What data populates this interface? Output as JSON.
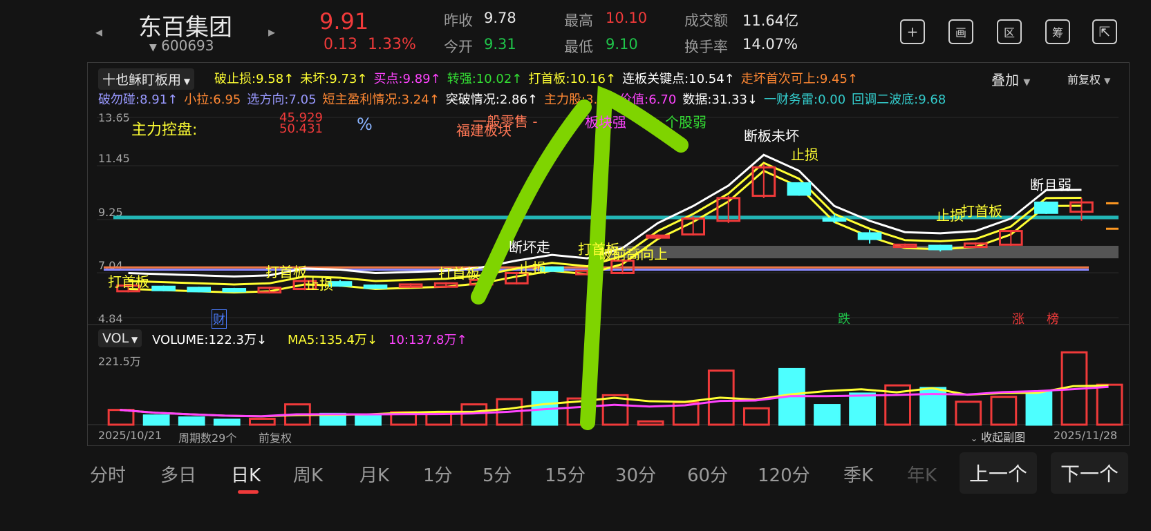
{
  "header": {
    "stock_name": "东百集团",
    "stock_code": "600693",
    "price": "9.91",
    "change": "0.13",
    "change_pct": "1.33%",
    "prev_close_label": "昨收",
    "prev_close": "9.78",
    "open_label": "今开",
    "open": "9.31",
    "high_label": "最高",
    "high": "10.10",
    "low_label": "最低",
    "low": "9.10",
    "amount_label": "成交额",
    "amount": "11.64亿",
    "turnover_label": "换手率",
    "turnover": "14.07%",
    "tools": [
      "+",
      "画",
      "区",
      "筹",
      "⇱"
    ]
  },
  "indicators": {
    "selector": "十也稣盯板用",
    "row1": [
      {
        "text": "破止损:9.58↑",
        "color": "#ffff33"
      },
      {
        "text": "未坏:9.73↑",
        "color": "#ffff33"
      },
      {
        "text": "买点:9.89↑",
        "color": "#ff44ff"
      },
      {
        "text": "转强:10.02↑",
        "color": "#33dd33"
      },
      {
        "text": "打首板:10.16↑",
        "color": "#ffff33"
      },
      {
        "text": "连板关键点:10.54↑",
        "color": "#ffffff"
      },
      {
        "text": "走坏首次可上:9.45↑",
        "color": "#ff8833"
      }
    ],
    "row2": [
      {
        "text": "破勿碰:8.91↑",
        "color": "#9999ff"
      },
      {
        "text": "小拉:6.95",
        "color": "#ff8833"
      },
      {
        "text": "选方向:7.05",
        "color": "#9999ff"
      },
      {
        "text": "短主盈利情况:3.24↑",
        "color": "#ff8833"
      },
      {
        "text": "突破情况:2.86↑",
        "color": "#ffffff"
      },
      {
        "text": "主力股:3.21",
        "color": "#ff8833"
      },
      {
        "text": "价值:6.70",
        "color": "#ff44ff"
      },
      {
        "text": "数据:31.33↓",
        "color": "#ffffff"
      },
      {
        "text": "一财务雷:0.00",
        "color": "#33cccc"
      },
      {
        "text": "回调二波底:9.68",
        "color": "#33cccc"
      }
    ],
    "overlay": "叠加",
    "adjust": "前复权"
  },
  "price_axis": [
    "13.65",
    "11.45",
    "9.25",
    "7.04",
    "4.84"
  ],
  "chart_notes": {
    "main_force": "主力控盘:",
    "main_force_pct1": "45.929",
    "main_force_pct2": "50.431",
    "pct_sign": "%",
    "sector1": "福建板块",
    "sector2": "一般零售 -",
    "sector_strength": "板块强",
    "stock_weak": "个股弱",
    "labels": [
      {
        "text": "打首板",
        "color": "#ffff33"
      },
      {
        "text": "打首板",
        "color": "#ffff33"
      },
      {
        "text": "止损",
        "color": "#ffff33"
      },
      {
        "text": "打首板",
        "color": "#ffff33"
      },
      {
        "text": "断坏走",
        "color": "#ffffff"
      },
      {
        "text": "止损",
        "color": "#ffff33"
      },
      {
        "text": "打首板",
        "color": "#ffff33"
      },
      {
        "text": "破前高向上",
        "color": "#ffff33"
      },
      {
        "text": "断板未坏",
        "color": "#ffffff"
      },
      {
        "text": "止损",
        "color": "#ffff33"
      },
      {
        "text": "止损",
        "color": "#ffff33"
      },
      {
        "text": "打首板",
        "color": "#ffff33"
      },
      {
        "text": "断且弱",
        "color": "#ffffff"
      }
    ],
    "tags": [
      {
        "text": "财",
        "color": "#4a7cff"
      },
      {
        "text": "跌",
        "color": "#1fc44a"
      },
      {
        "text": "涨",
        "color": "#f03a3a"
      },
      {
        "text": "榜",
        "color": "#f03a3a"
      }
    ]
  },
  "volume": {
    "selector": "VOL",
    "volume": "VOLUME:122.3万↓",
    "ma5": "MA5:135.4万↓",
    "ma10": "10:137.8万↑",
    "axis_max": "221.5万",
    "max_value": 221.5
  },
  "footer": {
    "start_date": "2025/10/21",
    "period": "周期数29个",
    "adjust": "前复权",
    "collapse": "收起副图",
    "end_date": "2025/11/28"
  },
  "tabs": [
    "分时",
    "多日",
    "日K",
    "周K",
    "月K",
    "1分",
    "5分",
    "15分",
    "30分",
    "60分",
    "120分",
    "季K",
    "年K"
  ],
  "active_tab": "日K",
  "prev_button": "上一个",
  "next_button": "下一个",
  "chart_data": {
    "type": "candlestick",
    "ylim": [
      4.84,
      13.65
    ],
    "candles": [
      {
        "o": 6.0,
        "c": 6.25,
        "h": 6.3,
        "l": 5.95,
        "up": true
      },
      {
        "o": 6.2,
        "c": 6.05,
        "h": 6.25,
        "l": 6.0,
        "up": false
      },
      {
        "o": 6.15,
        "c": 6.0,
        "h": 6.2,
        "l": 5.95,
        "up": false
      },
      {
        "o": 6.1,
        "c": 6.0,
        "h": 6.15,
        "l": 5.95,
        "up": false
      },
      {
        "o": 5.95,
        "c": 6.15,
        "h": 6.2,
        "l": 5.9,
        "up": true
      },
      {
        "o": 6.1,
        "c": 6.45,
        "h": 6.6,
        "l": 6.05,
        "up": true
      },
      {
        "o": 6.4,
        "c": 6.25,
        "h": 6.5,
        "l": 6.2,
        "up": false
      },
      {
        "o": 6.25,
        "c": 6.15,
        "h": 6.3,
        "l": 6.1,
        "up": false
      },
      {
        "o": 6.2,
        "c": 6.3,
        "h": 6.35,
        "l": 6.15,
        "up": true
      },
      {
        "o": 6.2,
        "c": 6.35,
        "h": 6.4,
        "l": 6.15,
        "up": true
      },
      {
        "o": 6.3,
        "c": 6.5,
        "h": 6.55,
        "l": 6.25,
        "up": true
      },
      {
        "o": 6.35,
        "c": 6.8,
        "h": 6.85,
        "l": 6.3,
        "up": true
      },
      {
        "o": 6.9,
        "c": 7.05,
        "h": 7.1,
        "l": 6.85,
        "up": false
      },
      {
        "o": 6.9,
        "c": 6.75,
        "h": 6.95,
        "l": 6.7,
        "up": true
      },
      {
        "o": 6.8,
        "c": 7.35,
        "h": 7.4,
        "l": 6.75,
        "up": true
      },
      {
        "o": 8.45,
        "c": 8.45,
        "h": 8.5,
        "l": 8.4,
        "up": true
      },
      {
        "o": 8.5,
        "c": 9.2,
        "h": 9.3,
        "l": 8.45,
        "up": true
      },
      {
        "o": 9.1,
        "c": 10.1,
        "h": 10.2,
        "l": 9.0,
        "up": true
      },
      {
        "o": 10.2,
        "c": 11.45,
        "h": 11.6,
        "l": 10.1,
        "up": true
      },
      {
        "o": 10.75,
        "c": 10.25,
        "h": 10.8,
        "l": 10.2,
        "up": false
      },
      {
        "o": 9.2,
        "c": 9.2,
        "h": 9.4,
        "l": 9.0,
        "up": false
      },
      {
        "o": 8.55,
        "c": 8.3,
        "h": 8.7,
        "l": 8.1,
        "up": false
      },
      {
        "o": 8.05,
        "c": 7.95,
        "h": 8.1,
        "l": 7.9,
        "up": true
      },
      {
        "o": 8.0,
        "c": 7.85,
        "h": 8.05,
        "l": 7.75,
        "up": false
      },
      {
        "o": 7.95,
        "c": 8.1,
        "h": 8.15,
        "l": 7.9,
        "up": true
      },
      {
        "o": 8.05,
        "c": 8.65,
        "h": 8.7,
        "l": 8.0,
        "up": true
      },
      {
        "o": 9.45,
        "c": 9.9,
        "h": 9.95,
        "l": 9.4,
        "up": false
      },
      {
        "o": 9.5,
        "c": 9.91,
        "h": 10.1,
        "l": 9.1,
        "up": true
      }
    ],
    "volumes": [
      45,
      28,
      22,
      15,
      18,
      62,
      33,
      29,
      38,
      35,
      62,
      78,
      100,
      80,
      90,
      10,
      68,
      165,
      50,
      170,
      60,
      95,
      120,
      112,
      70,
      85,
      100,
      221,
      122
    ]
  }
}
